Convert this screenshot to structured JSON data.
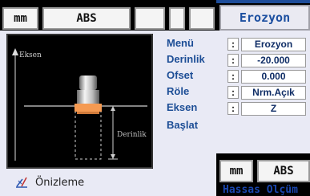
{
  "top_tabs": {
    "unit": "mm",
    "mode": "ABS",
    "empty1": "",
    "empty2": "",
    "empty3": ""
  },
  "title": "Erozyon",
  "preview": {
    "axis_label": "Eksen",
    "depth_label": "Derinlik",
    "caption": "Önizleme"
  },
  "params": [
    {
      "label": "Menü",
      "value": "Erozyon"
    },
    {
      "label": "Derinlik",
      "value": "-20.000"
    },
    {
      "label": "Ofset",
      "value": "0.000"
    },
    {
      "label": "Röle",
      "value": "Nrm.Açık"
    },
    {
      "label": "Eksen",
      "value": "Z"
    },
    {
      "label": "Başlat",
      "value": ""
    }
  ],
  "colon": ":",
  "mini_tabs": {
    "unit": "mm",
    "mode": "ABS",
    "footer": "Hassas Ölçüm"
  },
  "colors": {
    "accent": "#1c4fa0",
    "panel": "#e9eaf5",
    "electrode_band": "#f59a52"
  }
}
